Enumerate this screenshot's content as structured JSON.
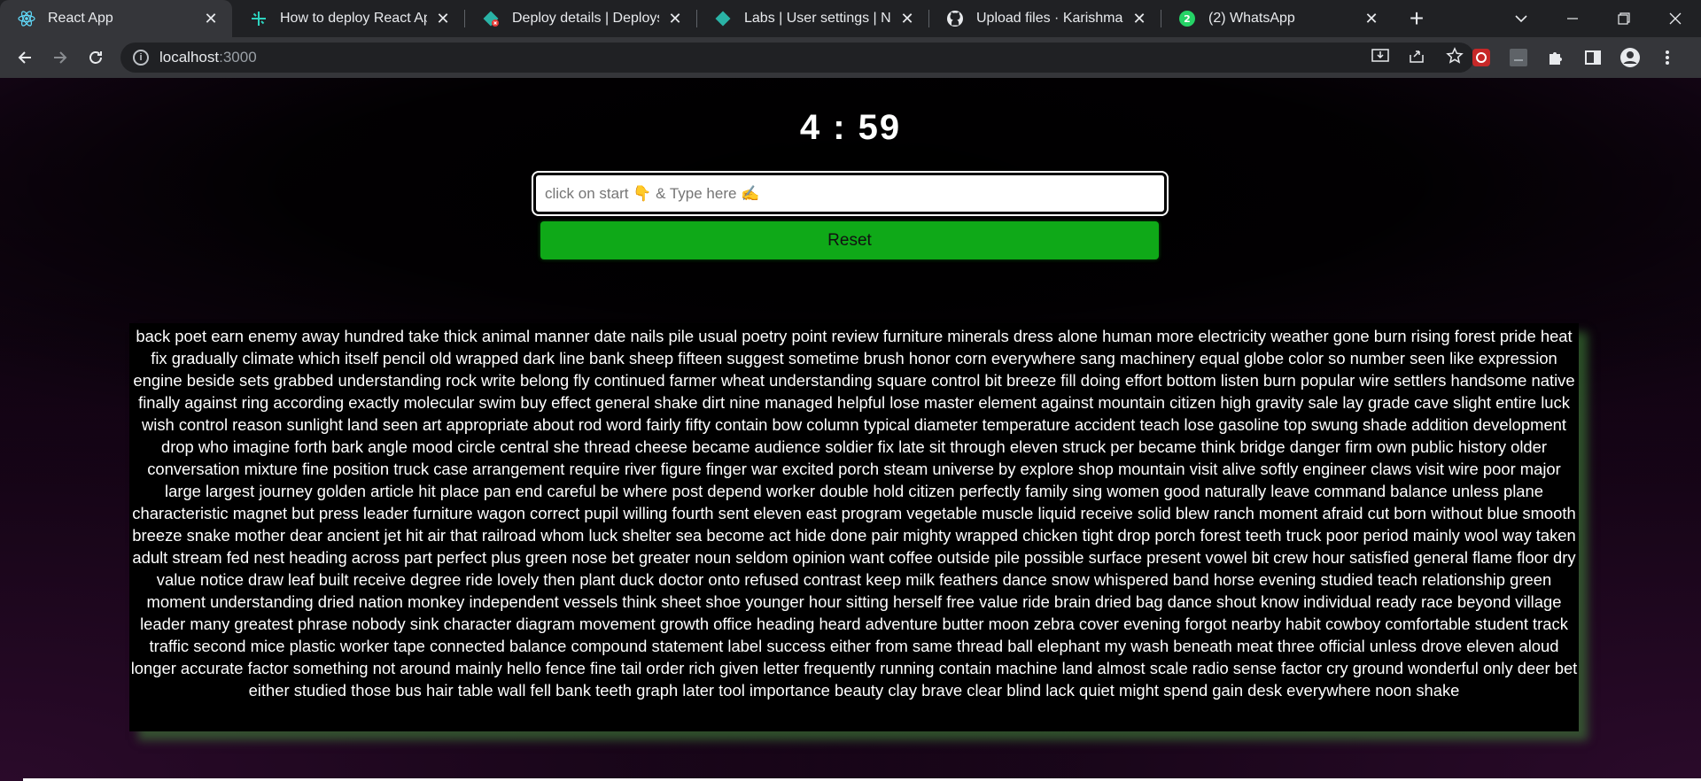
{
  "browser": {
    "tabs": [
      {
        "title": "React App",
        "icon": "react-icon",
        "active": true
      },
      {
        "title": "How to deploy React Apps fre",
        "icon": "hashnode-icon",
        "active": false
      },
      {
        "title": "Deploy details | Deploys | vo",
        "icon": "netlify-error-icon",
        "active": false
      },
      {
        "title": "Labs | User settings | Netlify",
        "icon": "netlify-icon",
        "active": false
      },
      {
        "title": "Upload files · KarishmaSayy",
        "icon": "github-icon",
        "active": false
      },
      {
        "title": "(2) WhatsApp",
        "icon": "whatsapp-icon",
        "active": false,
        "badge": "2"
      }
    ],
    "close_glyph": "✕",
    "new_tab_glyph": "+",
    "address": {
      "host": "localhost",
      "port": ":3000"
    }
  },
  "app": {
    "timer": "4 : 59",
    "input_placeholder": "click on start 👇 & Type here ✍️",
    "reset_label": "Reset",
    "words": "back poet earn enemy away hundred take thick animal manner date nails pile usual poetry point review furniture minerals dress alone human more electricity weather gone burn rising forest pride heat fix gradually climate which itself pencil old wrapped dark line bank sheep fifteen suggest sometime brush honor corn everywhere sang machinery equal globe color so number seen like expression engine beside sets grabbed understanding rock write belong fly continued farmer wheat understanding square control bit breeze fill doing effort bottom listen burn popular wire settlers handsome native finally against ring according exactly molecular swim buy effect general shake dirt nine managed helpful lose master element against mountain citizen high gravity sale lay grade cave slight entire luck wish control reason sunlight land seen art appropriate about rod word fairly fifty contain bow column typical diameter temperature accident teach lose gasoline top swung shade addition development drop who imagine forth bark angle mood circle central she thread cheese became audience soldier fix late sit through eleven struck per became think bridge danger firm own public history older conversation mixture fine position truck case arrangement require river figure finger war excited porch steam universe by explore shop mountain visit alive softly engineer claws visit wire poor major large largest journey golden article hit place pan end careful be where post depend worker double hold citizen perfectly family sing women good naturally leave command balance unless plane characteristic magnet but press leader furniture wagon correct pupil willing fourth sent eleven east program vegetable muscle liquid receive solid blew ranch moment afraid cut born without blue smooth breeze snake mother dear ancient jet hit air that railroad whom luck shelter sea become act hide done pair mighty wrapped chicken tight drop porch forest teeth truck poor period mainly wool way taken adult stream fed nest heading across part perfect plus green nose bet greater noun seldom opinion want coffee outside pile possible surface present vowel bit crew hour satisfied general flame floor dry value notice draw leaf built receive degree ride lovely then plant duck doctor onto refused contrast keep milk feathers dance snow whispered band horse evening studied teach relationship green moment understanding dried nation monkey independent vessels think sheet shoe younger hour sitting herself free value ride brain dried bag dance shout know individual ready race beyond village leader many greatest phrase nobody sink character diagram movement growth office heading heard adventure butter moon zebra cover evening forgot nearby habit cowboy comfortable student track traffic second mice plastic worker tape connected balance compound statement label success either from same thread ball elephant my wash beneath meat three official unless drove eleven aloud longer accurate factor something not around mainly hello fence fine tail order rich given letter frequently running contain machine land almost scale radio sense factor cry ground wonderful only deer bet either studied those bus hair table wall fell bank teeth graph later tool importance beauty clay brave clear blind lack quiet might spend gain desk everywhere noon shake"
  },
  "colors": {
    "reset_green": "#0fa918",
    "tab_bg": "#202124",
    "active_tab_bg": "#35363a",
    "shadow_green": "#448c3c"
  }
}
